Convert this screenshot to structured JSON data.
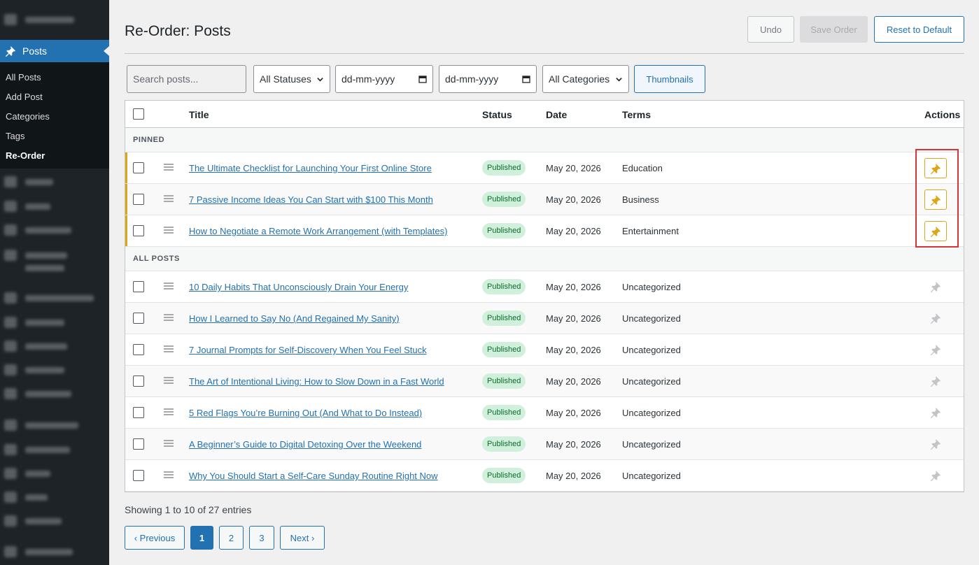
{
  "sidebar": {
    "posts_label": "Posts",
    "submenu": [
      {
        "label": "All Posts",
        "current": false
      },
      {
        "label": "Add Post",
        "current": false
      },
      {
        "label": "Categories",
        "current": false
      },
      {
        "label": "Tags",
        "current": false
      },
      {
        "label": "Re-Order",
        "current": true
      }
    ]
  },
  "header": {
    "title": "Re-Order: Posts",
    "undo_label": "Undo",
    "save_label": "Save Order",
    "reset_label": "Reset to Default"
  },
  "filters": {
    "search_placeholder": "Search posts...",
    "status_value": "All Statuses",
    "date_from": "dd-mm-yyyy",
    "date_to": "dd-mm-yyyy",
    "category_value": "All Categories",
    "thumbnails_label": "Thumbnails"
  },
  "table": {
    "columns": {
      "title": "Title",
      "status": "Status",
      "date": "Date",
      "terms": "Terms",
      "actions": "Actions"
    },
    "pinned_heading": "PINNED",
    "all_heading": "ALL POSTS",
    "pinned_rows": [
      {
        "title": "The Ultimate Checklist for Launching Your First Online Store",
        "status": "Published",
        "date": "May 20, 2026",
        "terms": "Education"
      },
      {
        "title": "7 Passive Income Ideas You Can Start with $100 This Month",
        "status": "Published",
        "date": "May 20, 2026",
        "terms": "Business"
      },
      {
        "title": "How to Negotiate a Remote Work Arrangement (with Templates)",
        "status": "Published",
        "date": "May 20, 2026",
        "terms": "Entertainment"
      }
    ],
    "rows": [
      {
        "title": "10 Daily Habits That Unconsciously Drain Your Energy",
        "status": "Published",
        "date": "May 20, 2026",
        "terms": "Uncategorized"
      },
      {
        "title": "How I Learned to Say No (And Regained My Sanity)",
        "status": "Published",
        "date": "May 20, 2026",
        "terms": "Uncategorized"
      },
      {
        "title": "7 Journal Prompts for Self-Discovery When You Feel Stuck",
        "status": "Published",
        "date": "May 20, 2026",
        "terms": "Uncategorized"
      },
      {
        "title": "The Art of Intentional Living: How to Slow Down in a Fast World",
        "status": "Published",
        "date": "May 20, 2026",
        "terms": "Uncategorized"
      },
      {
        "title": "5 Red Flags You’re Burning Out (And What to Do Instead)",
        "status": "Published",
        "date": "May 20, 2026",
        "terms": "Uncategorized"
      },
      {
        "title": "A Beginner’s Guide to Digital Detoxing Over the Weekend",
        "status": "Published",
        "date": "May 20, 2026",
        "terms": "Uncategorized"
      },
      {
        "title": "Why You Should Start a Self-Care Sunday Routine Right Now",
        "status": "Published",
        "date": "May 20, 2026",
        "terms": "Uncategorized"
      }
    ]
  },
  "footer": {
    "showing": "Showing 1 to 10 of 27 entries",
    "prev_label": "‹ Previous",
    "pages": [
      "1",
      "2",
      "3"
    ],
    "current_page": "1",
    "next_label": "Next ›"
  },
  "colors": {
    "accent": "#2271b1",
    "pin": "#dba617",
    "highlight": "#d63638",
    "badge_bg": "#d1f0dc"
  },
  "icons": {
    "pin_active": "pushpin-icon",
    "pin_inactive": "pushpin-icon",
    "drag": "drag-handle-icon"
  }
}
